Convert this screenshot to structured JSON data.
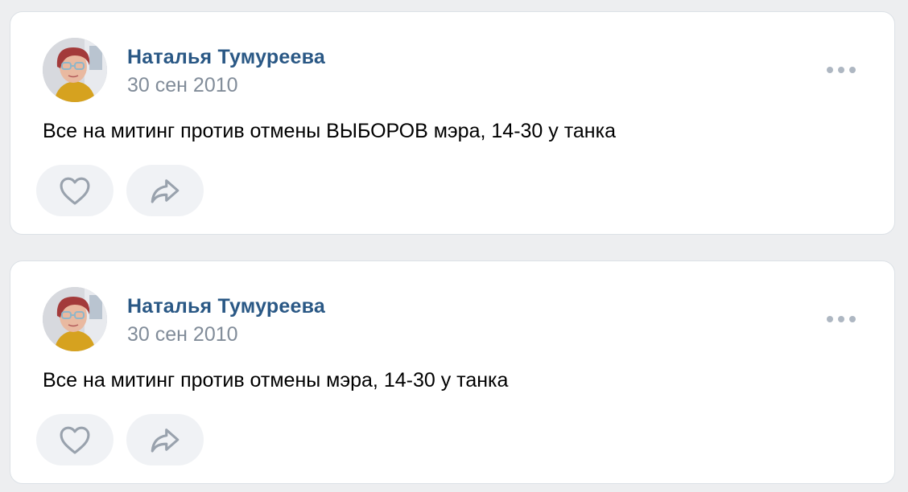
{
  "colors": {
    "background": "#edeef0",
    "card": "#ffffff",
    "author": "#2a5885",
    "date": "#818c99",
    "icon": "#99a2ad",
    "button_bg": "#f0f2f5"
  },
  "posts": [
    {
      "author": "Наталья Тумуреева",
      "date": "30 сен 2010",
      "text": "Все на митинг против отмены ВЫБОРОВ мэра, 14-30 у танка",
      "icons": {
        "like": "heart-icon",
        "share": "share-arrow-icon",
        "more": "more-dots-icon"
      }
    },
    {
      "author": "Наталья Тумуреева",
      "date": "30 сен 2010",
      "text": "Все на митинг против отмены мэра, 14-30 у танка",
      "icons": {
        "like": "heart-icon",
        "share": "share-arrow-icon",
        "more": "more-dots-icon"
      }
    }
  ]
}
